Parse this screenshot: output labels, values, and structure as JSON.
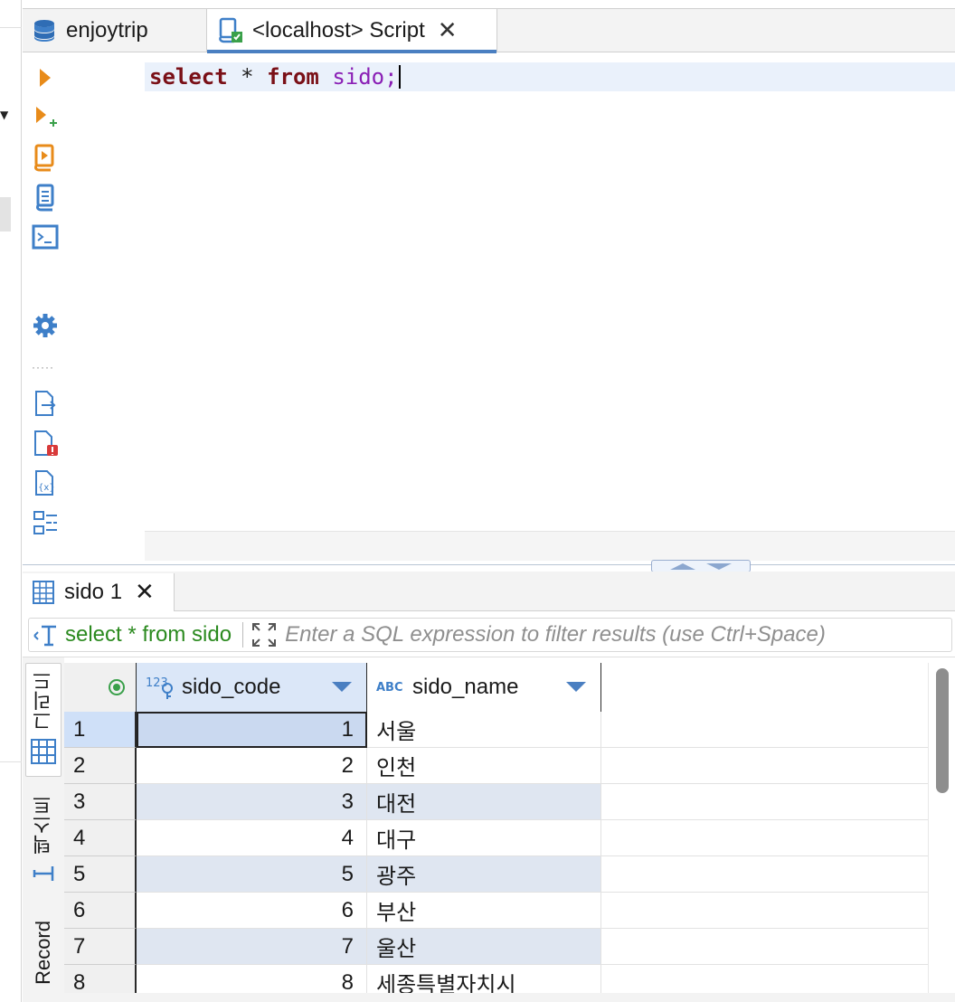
{
  "tabs": [
    {
      "label": "enjoytrip",
      "icon": "database-icon"
    },
    {
      "label": "<localhost> Script",
      "icon": "sql-script-icon",
      "close": "✕"
    }
  ],
  "editor": {
    "line1": {
      "kw1": "select",
      "op": "*",
      "kw2": "from",
      "ident": "sido;"
    }
  },
  "result_tab": {
    "label": "sido 1",
    "close": "✕"
  },
  "filter": {
    "query": "select * from sido",
    "placeholder": "Enter a SQL expression to filter results (use Ctrl+Space)"
  },
  "side_tabs": {
    "grid": "그리드",
    "text": "텍스트",
    "record": "Record"
  },
  "columns": [
    {
      "name": "sido_code",
      "type_badge": "123"
    },
    {
      "name": "sido_name",
      "type_badge": "ABC"
    }
  ],
  "rows": [
    {
      "rn": "1",
      "code": "1",
      "name": "서울"
    },
    {
      "rn": "2",
      "code": "2",
      "name": "인천"
    },
    {
      "rn": "3",
      "code": "3",
      "name": "대전"
    },
    {
      "rn": "4",
      "code": "4",
      "name": "대구"
    },
    {
      "rn": "5",
      "code": "5",
      "name": "광주"
    },
    {
      "rn": "6",
      "code": "6",
      "name": "부산"
    },
    {
      "rn": "7",
      "code": "7",
      "name": "울산"
    },
    {
      "rn": "8",
      "code": "8",
      "name": "세종특별자치시"
    }
  ],
  "colors": {
    "accent": "#4a7fc1",
    "keyword": "#7a1017",
    "identifier": "#8a1fb5",
    "filter_query": "#2b8a1f",
    "icon_orange": "#e88b1a"
  }
}
